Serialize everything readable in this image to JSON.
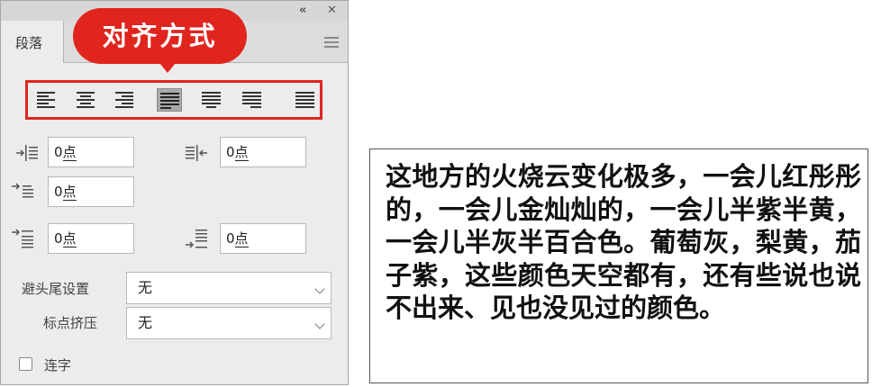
{
  "panel": {
    "titlebar": {
      "collapse_icon": "double-chevron-icon",
      "close_icon": "close-icon"
    },
    "tab": {
      "label": "段落"
    },
    "menu_icon": "panel-menu-icon",
    "callout": {
      "text": "对齐方式",
      "color": "#e0251f"
    },
    "alignment_buttons": [
      {
        "name": "align-left-icon",
        "active": false
      },
      {
        "name": "align-center-icon",
        "active": false
      },
      {
        "name": "align-right-icon",
        "active": false
      },
      {
        "name": "justify-last-left-icon",
        "active": true
      },
      {
        "name": "justify-last-center-icon",
        "active": false
      },
      {
        "name": "justify-last-right-icon",
        "active": false
      },
      {
        "name": "justify-all-icon",
        "active": false
      }
    ],
    "indent": {
      "left": {
        "value": "0",
        "unit": "点"
      },
      "right": {
        "value": "0",
        "unit": "点"
      },
      "first_line": {
        "value": "0",
        "unit": "点"
      }
    },
    "spacing": {
      "before": {
        "value": "0",
        "unit": "点"
      },
      "after": {
        "value": "0",
        "unit": "点"
      }
    },
    "kinsoku": {
      "label": "避头尾设置",
      "value": "无"
    },
    "mojikumi": {
      "label": "标点挤压",
      "value": "无"
    },
    "hyphenate": {
      "label": "连字",
      "checked": false
    }
  },
  "sample": {
    "text": "这地方的火烧云变化极多，一会儿红彤彤的，一会儿金灿灿的，一会儿半紫半黄，一会儿半灰半百合色。葡萄灰，梨黄，茄子紫，这些颜色天空都有，还有些说也说不出来、见也没见过的颜色。"
  }
}
